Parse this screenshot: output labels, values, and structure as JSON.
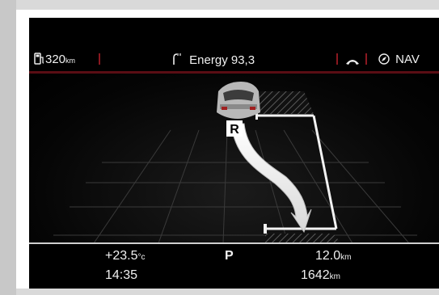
{
  "status": {
    "range": "320",
    "range_unit": "km",
    "energy_label": "Energy 93,3",
    "nav_label": "NAV"
  },
  "parking": {
    "gear_marker": "R"
  },
  "info": {
    "temperature": "+23.5",
    "temperature_unit": "°c",
    "gear": "P",
    "trip_distance": "12.0",
    "trip_unit": "km",
    "time": "14:35",
    "odometer": "1642",
    "odometer_unit": "km"
  },
  "colors": {
    "accent_red": "#8a1820",
    "background": "#000000",
    "text": "#f0f0f0"
  },
  "icons": [
    "fuel-pump-icon",
    "energy-plug-icon",
    "phone-handset-icon",
    "compass-icon"
  ]
}
